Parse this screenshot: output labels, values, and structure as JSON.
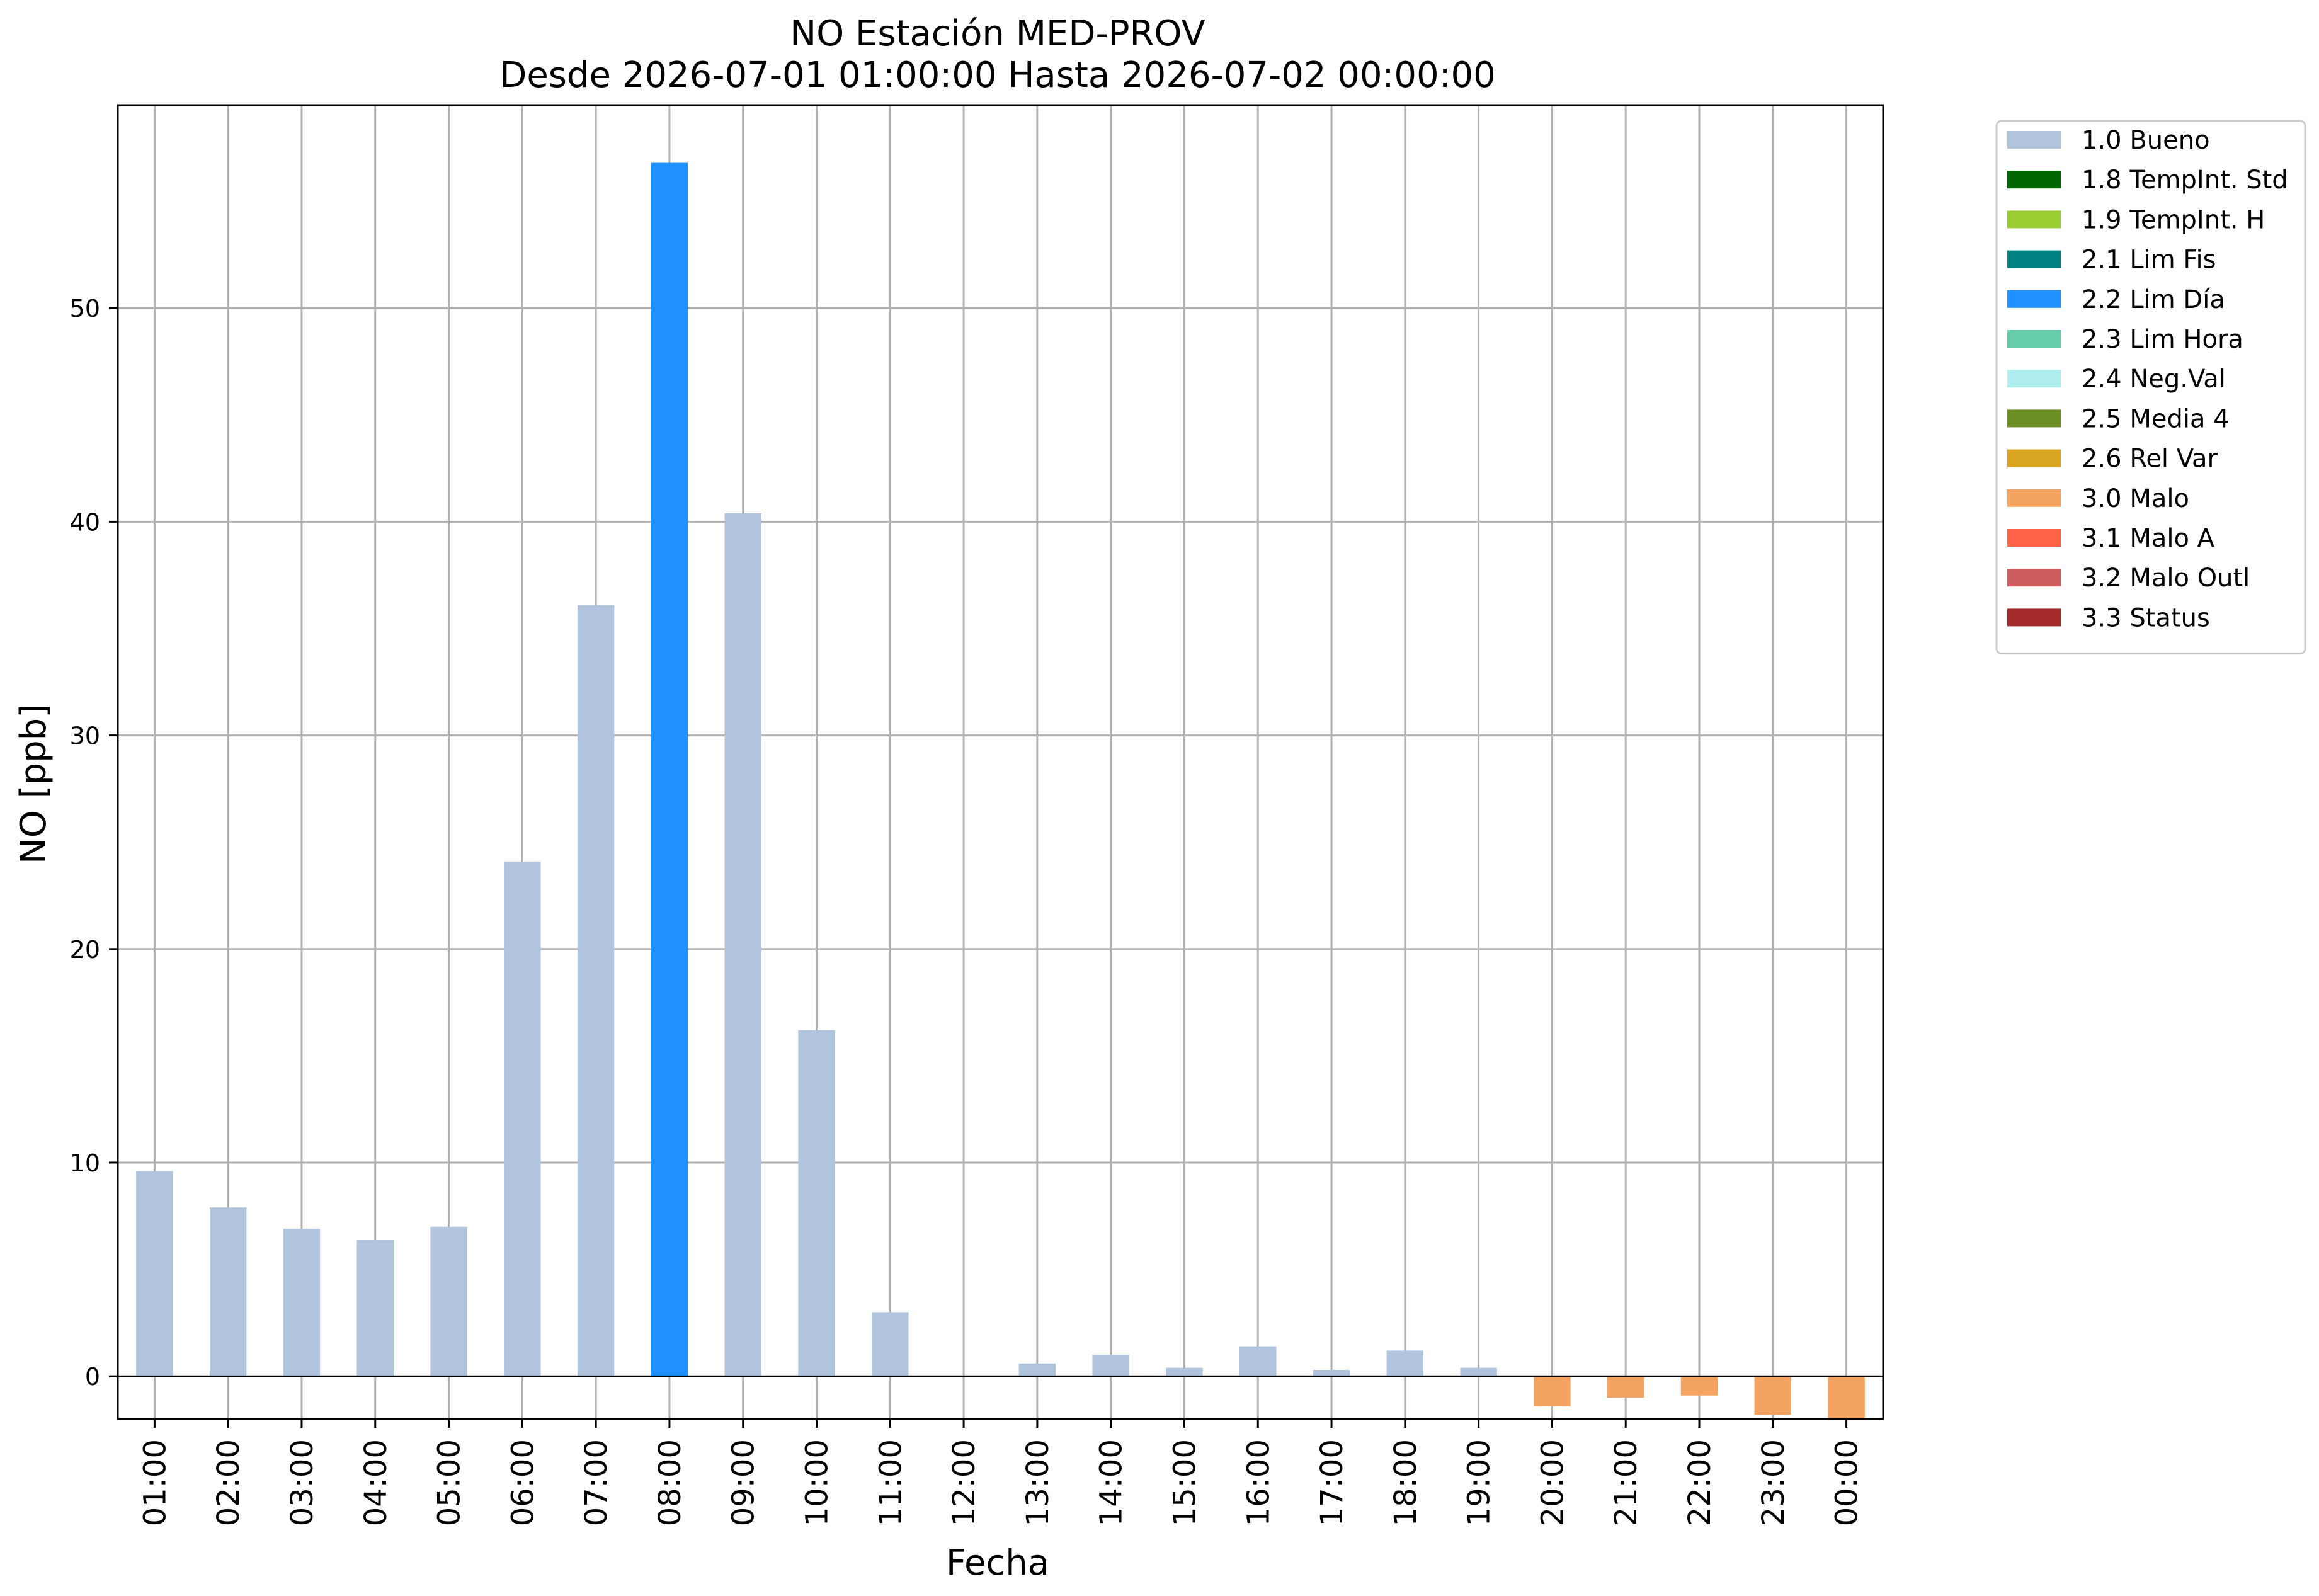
{
  "chart_data": {
    "type": "bar",
    "title": "NO Estación MED-PROV",
    "subtitle": "Desde 2026-07-01 01:00:00 Hasta 2026-07-02 00:00:00",
    "xlabel": "Fecha",
    "ylabel": "NO [ppb]",
    "ylim": [
      -2.0,
      59.5
    ],
    "yticks": [
      0,
      10,
      20,
      30,
      40,
      50
    ],
    "grid": true,
    "legend_position": "outside-top-right",
    "categories": [
      "01:00",
      "02:00",
      "03:00",
      "04:00",
      "05:00",
      "06:00",
      "07:00",
      "08:00",
      "09:00",
      "10:00",
      "11:00",
      "12:00",
      "13:00",
      "14:00",
      "15:00",
      "16:00",
      "17:00",
      "18:00",
      "19:00",
      "20:00",
      "21:00",
      "22:00",
      "23:00",
      "00:00"
    ],
    "values": [
      9.6,
      7.9,
      6.9,
      6.4,
      7.0,
      24.1,
      36.1,
      56.8,
      40.4,
      16.2,
      3.0,
      null,
      0.6,
      1.0,
      0.4,
      1.4,
      0.3,
      1.2,
      0.4,
      -1.4,
      -1.0,
      -0.9,
      -1.8,
      -2.0
    ],
    "flags": [
      "1.0 Bueno",
      "1.0 Bueno",
      "1.0 Bueno",
      "1.0 Bueno",
      "1.0 Bueno",
      "1.0 Bueno",
      "1.0 Bueno",
      "2.2 Lim Día",
      "1.0 Bueno",
      "1.0 Bueno",
      "1.0 Bueno",
      null,
      "1.0 Bueno",
      "1.0 Bueno",
      "1.0 Bueno",
      "1.0 Bueno",
      "1.0 Bueno",
      "1.0 Bueno",
      "1.0 Bueno",
      "3.0 Malo",
      "3.0 Malo",
      "3.0 Malo",
      "3.0 Malo",
      "3.0 Malo"
    ],
    "legend": [
      {
        "label": "1.0 Bueno",
        "color": "#b0c4de"
      },
      {
        "label": "1.8 TempInt. Std",
        "color": "#006400"
      },
      {
        "label": "1.9 TempInt. H",
        "color": "#9acd32"
      },
      {
        "label": "2.1 Lim Fis",
        "color": "#008080"
      },
      {
        "label": "2.2 Lim Día",
        "color": "#1e90ff"
      },
      {
        "label": "2.3 Lim Hora",
        "color": "#66cdaa"
      },
      {
        "label": "2.4 Neg.Val",
        "color": "#afeeee"
      },
      {
        "label": "2.5 Media 4",
        "color": "#6b8e23"
      },
      {
        "label": "2.6 Rel Var",
        "color": "#daa520"
      },
      {
        "label": "3.0 Malo",
        "color": "#f4a460"
      },
      {
        "label": "3.1 Malo A",
        "color": "#ff6347"
      },
      {
        "label": "3.2 Malo Outl",
        "color": "#cd5c5c"
      },
      {
        "label": "3.3 Status",
        "color": "#a52a2a"
      }
    ]
  }
}
